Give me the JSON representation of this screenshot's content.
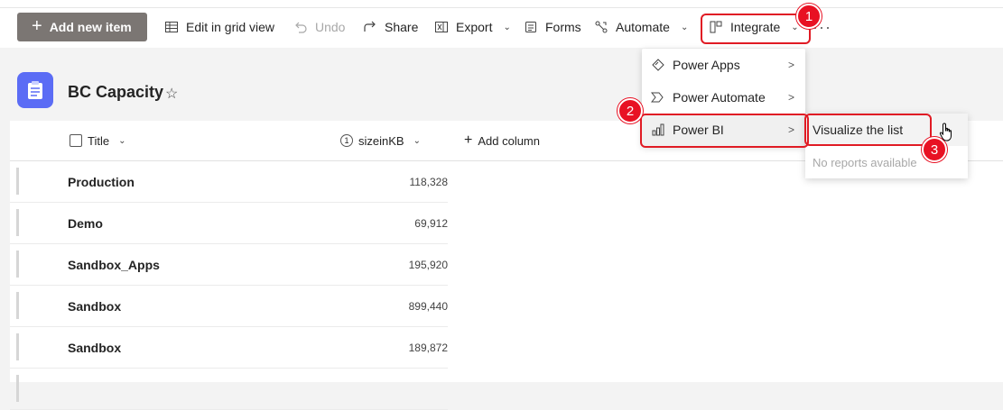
{
  "toolbar": {
    "add_label": "Add new item",
    "edit_grid_label": "Edit in grid view",
    "undo_label": "Undo",
    "share_label": "Share",
    "export_label": "Export",
    "forms_label": "Forms",
    "automate_label": "Automate",
    "integrate_label": "Integrate",
    "more_label": "···"
  },
  "list": {
    "title": "BC Capacity"
  },
  "columns": {
    "title": "Title",
    "size": "sizeinKB",
    "add_column": "Add column"
  },
  "rows": [
    {
      "title": "Production",
      "value": "118,328"
    },
    {
      "title": "Demo",
      "value": "69,912"
    },
    {
      "title": "Sandbox_Apps",
      "value": "195,920"
    },
    {
      "title": "Sandbox",
      "value": "899,440"
    },
    {
      "title": "Sandbox",
      "value": "189,872"
    }
  ],
  "integrate_menu": {
    "items": [
      {
        "label": "Power Apps"
      },
      {
        "label": "Power Automate"
      },
      {
        "label": "Power BI"
      }
    ]
  },
  "powerbi_submenu": {
    "visualize_label": "Visualize the list",
    "no_reports_label": "No reports available"
  },
  "annotations": {
    "step1": "1",
    "step2": "2",
    "step3": "3"
  },
  "colors": {
    "accent_highlight": "#e01b24",
    "badge": "#e81123",
    "list_icon": "#5b6cf5",
    "add_button": "#7b7673"
  }
}
